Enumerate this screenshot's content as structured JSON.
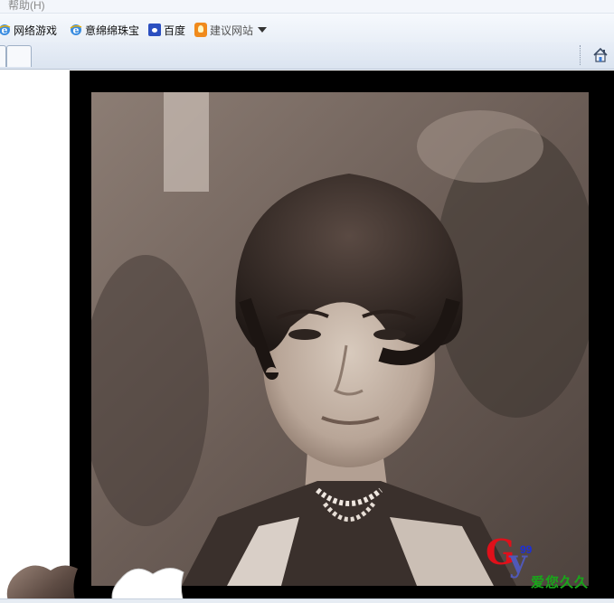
{
  "menu": {
    "help_label": "帮助(H)"
  },
  "favorites": [
    {
      "label": "网络游戏",
      "icon": "ie-icon"
    },
    {
      "label": "意绵绵珠宝",
      "icon": "ie-icon"
    },
    {
      "label": "百度",
      "icon": "baidu-paw-icon"
    },
    {
      "label": "建议网站",
      "icon": "suggest-bulb-icon"
    }
  ],
  "tabs": {
    "new_tab_icon": "new-tab"
  },
  "toolbar": {
    "home_icon": "home-icon"
  },
  "watermark": {
    "g": "G",
    "y": "y",
    "num": "99",
    "text": "爱您久久"
  },
  "colors": {
    "accent_red": "#e0101a",
    "accent_blue": "#5059b8",
    "accent_green": "#19a61a",
    "frame": "#000000"
  }
}
